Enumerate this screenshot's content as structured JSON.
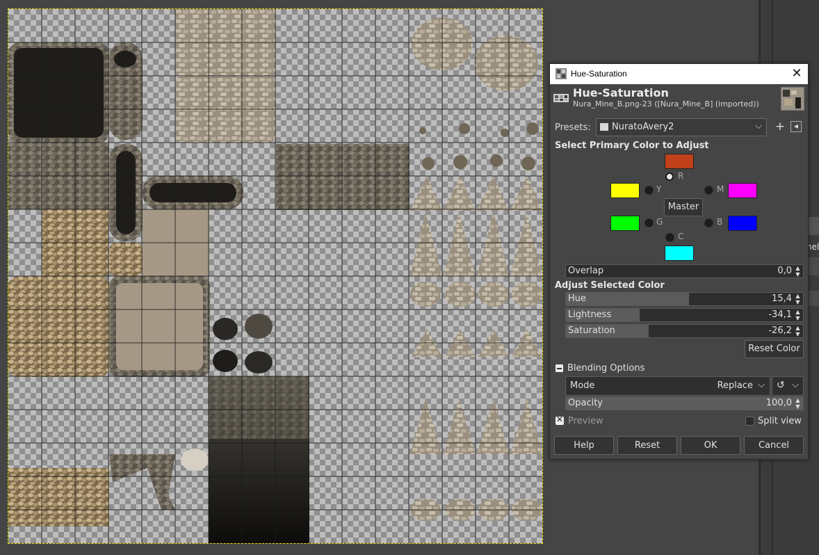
{
  "dialog": {
    "window_title": "Hue-Saturation",
    "header_title": "Hue-Saturation",
    "header_subtitle": "Nura_Mine_B.png-23 ([Nura_Mine_B] (imported))",
    "close_glyph": "✕"
  },
  "presets": {
    "label": "Presets:",
    "value": "NuratoAvery2",
    "add_glyph": "+",
    "menu_glyph": "◂"
  },
  "primary_color": {
    "heading": "Select Primary Color to Adjust",
    "selected": "R",
    "items": [
      {
        "key": "R",
        "label": "R",
        "color": "#c0401a"
      },
      {
        "key": "Y",
        "label": "Y",
        "color": "#ffff00"
      },
      {
        "key": "M",
        "label": "M",
        "color": "#ff00ff"
      },
      {
        "key": "G",
        "label": "G",
        "color": "#00ff00"
      },
      {
        "key": "B",
        "label": "B",
        "color": "#0000ff"
      },
      {
        "key": "C",
        "label": "C",
        "color": "#00ffff"
      }
    ],
    "master_label": "Master"
  },
  "overlap": {
    "label": "Overlap",
    "value": "0,0",
    "fraction": 0.0
  },
  "adjust": {
    "heading": "Adjust Selected Color",
    "hue": {
      "label": "Hue",
      "value": "15,4",
      "fraction": 0.52
    },
    "lightness": {
      "label": "Lightness",
      "value": "-34,1",
      "fraction": 0.31
    },
    "saturation": {
      "label": "Saturation",
      "value": "-26,2",
      "fraction": 0.35
    },
    "reset_label": "Reset Color"
  },
  "blending": {
    "heading": "Blending Options",
    "mode_label": "Mode",
    "mode_value": "Replace",
    "opacity_label": "Opacity",
    "opacity_value": "100,0",
    "opacity_fraction": 1.0
  },
  "options": {
    "preview_label": "Preview",
    "preview_checked": true,
    "split_label": "Split view",
    "split_checked": false
  },
  "buttons": {
    "help": "Help",
    "reset": "Reset",
    "ok": "OK",
    "cancel": "Cancel"
  },
  "dock": {
    "partial_tab_text": "nel"
  }
}
